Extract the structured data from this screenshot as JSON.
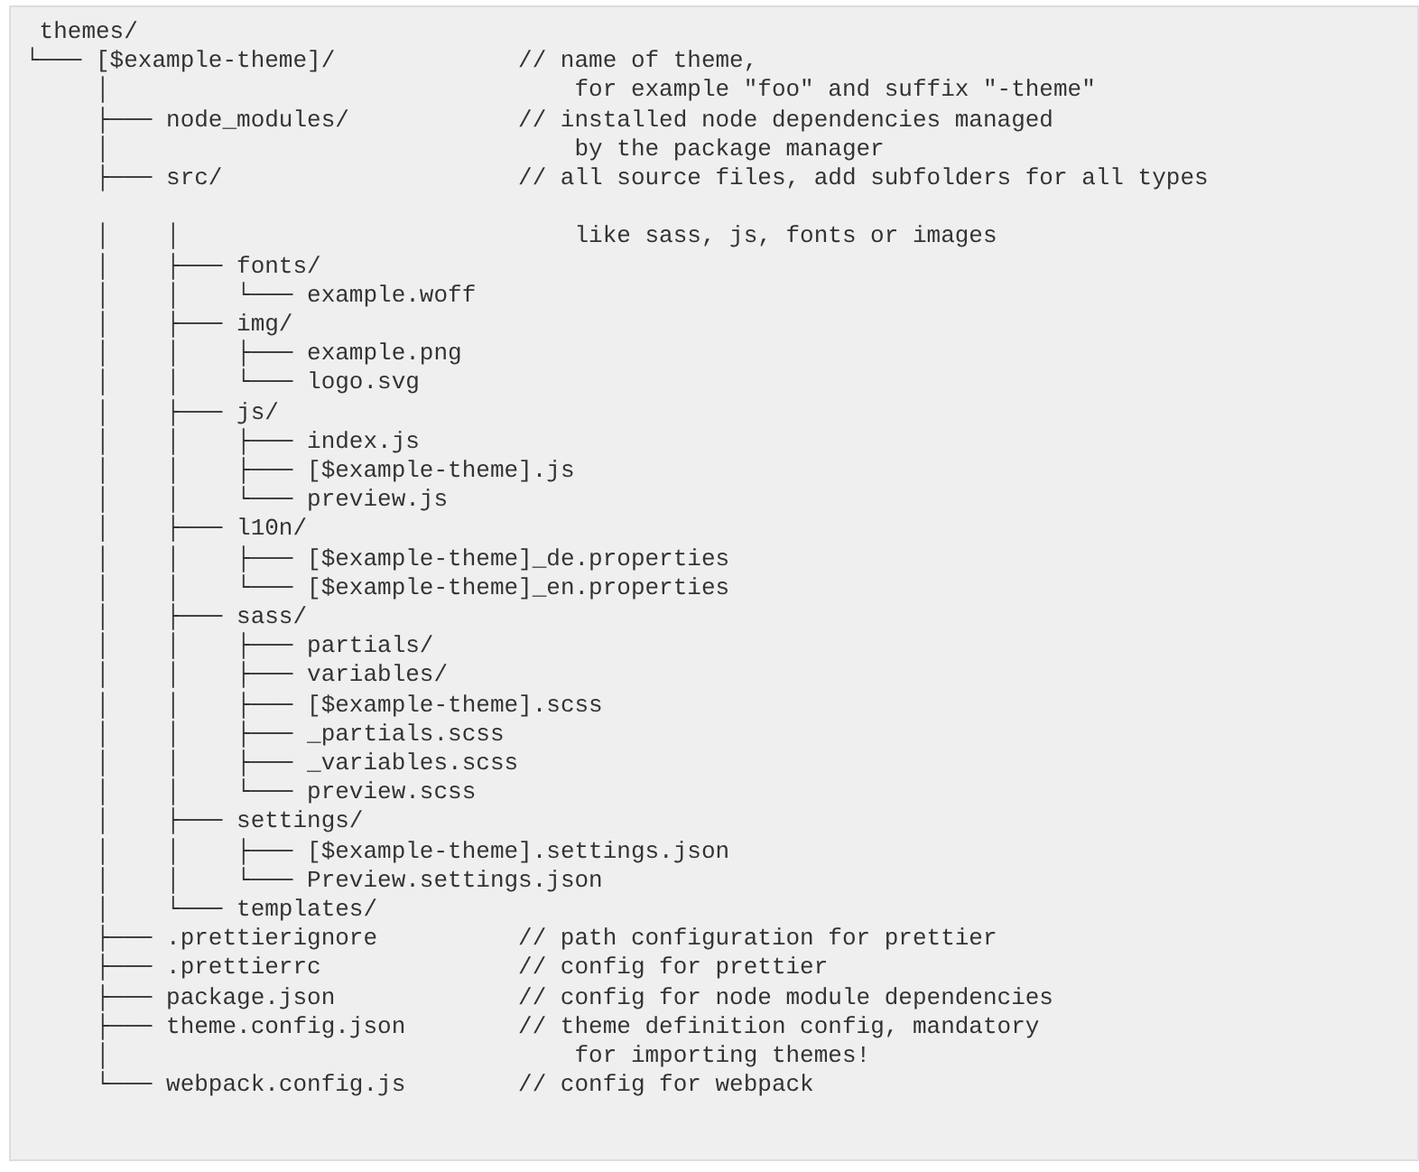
{
  "code_block": {
    "lines": [
      {
        "kind": "entry",
        "path": " themes/"
      },
      {
        "kind": "entry",
        "path": "└─── [$example-theme]/",
        "comment": "// name of theme,"
      },
      {
        "kind": "note",
        "path": "     │",
        "comment": "for example \"foo\" and suffix \"-theme\""
      },
      {
        "kind": "entry",
        "path": "     ├─── node_modules/",
        "comment": "// installed node dependencies managed"
      },
      {
        "kind": "note",
        "path": "     │",
        "comment": "by the package manager"
      },
      {
        "kind": "entry",
        "path": "     ├─── src/",
        "comment": "// all source files, add subfolders for all types"
      },
      {
        "kind": "blank"
      },
      {
        "kind": "note",
        "path": "     │    │",
        "comment": "like sass, js, fonts or images"
      },
      {
        "kind": "entry",
        "path": "     │    ├─── fonts/"
      },
      {
        "kind": "entry",
        "path": "     │    │    └─── example.woff"
      },
      {
        "kind": "entry",
        "path": "     │    ├─── img/"
      },
      {
        "kind": "entry",
        "path": "     │    │    ├─── example.png"
      },
      {
        "kind": "entry",
        "path": "     │    │    └─── logo.svg"
      },
      {
        "kind": "entry",
        "path": "     │    ├─── js/"
      },
      {
        "kind": "entry",
        "path": "     │    │    ├─── index.js"
      },
      {
        "kind": "entry",
        "path": "     │    │    ├─── [$example-theme].js"
      },
      {
        "kind": "entry",
        "path": "     │    │    └─── preview.js"
      },
      {
        "kind": "entry",
        "path": "     │    ├─── l10n/"
      },
      {
        "kind": "entry",
        "path": "     │    │    ├─── [$example-theme]_de.properties"
      },
      {
        "kind": "entry",
        "path": "     │    │    └─── [$example-theme]_en.properties"
      },
      {
        "kind": "entry",
        "path": "     │    ├─── sass/"
      },
      {
        "kind": "entry",
        "path": "     │    │    ├─── partials/"
      },
      {
        "kind": "entry",
        "path": "     │    │    ├─── variables/"
      },
      {
        "kind": "entry",
        "path": "     │    │    ├─── [$example-theme].scss"
      },
      {
        "kind": "entry",
        "path": "     │    │    ├─── _partials.scss"
      },
      {
        "kind": "entry",
        "path": "     │    │    ├─── _variables.scss"
      },
      {
        "kind": "entry",
        "path": "     │    │    └─── preview.scss"
      },
      {
        "kind": "entry",
        "path": "     │    ├─── settings/"
      },
      {
        "kind": "entry",
        "path": "     │    │    ├─── [$example-theme].settings.json"
      },
      {
        "kind": "entry",
        "path": "     │    │    └─── Preview.settings.json"
      },
      {
        "kind": "entry",
        "path": "     │    └─── templates/"
      },
      {
        "kind": "entry",
        "path": "     ├─── .prettierignore",
        "comment": "// path configuration for prettier"
      },
      {
        "kind": "entry",
        "path": "     ├─── .prettierrc",
        "comment": "// config for prettier"
      },
      {
        "kind": "entry",
        "path": "     ├─── package.json",
        "comment": "// config for node module dependencies"
      },
      {
        "kind": "entry",
        "path": "     ├─── theme.config.json",
        "comment": "// theme definition config, mandatory"
      },
      {
        "kind": "note",
        "path": "     │",
        "comment": "for importing themes!"
      },
      {
        "kind": "entry",
        "path": "     └─── webpack.config.js",
        "comment": "// config for webpack"
      }
    ]
  }
}
